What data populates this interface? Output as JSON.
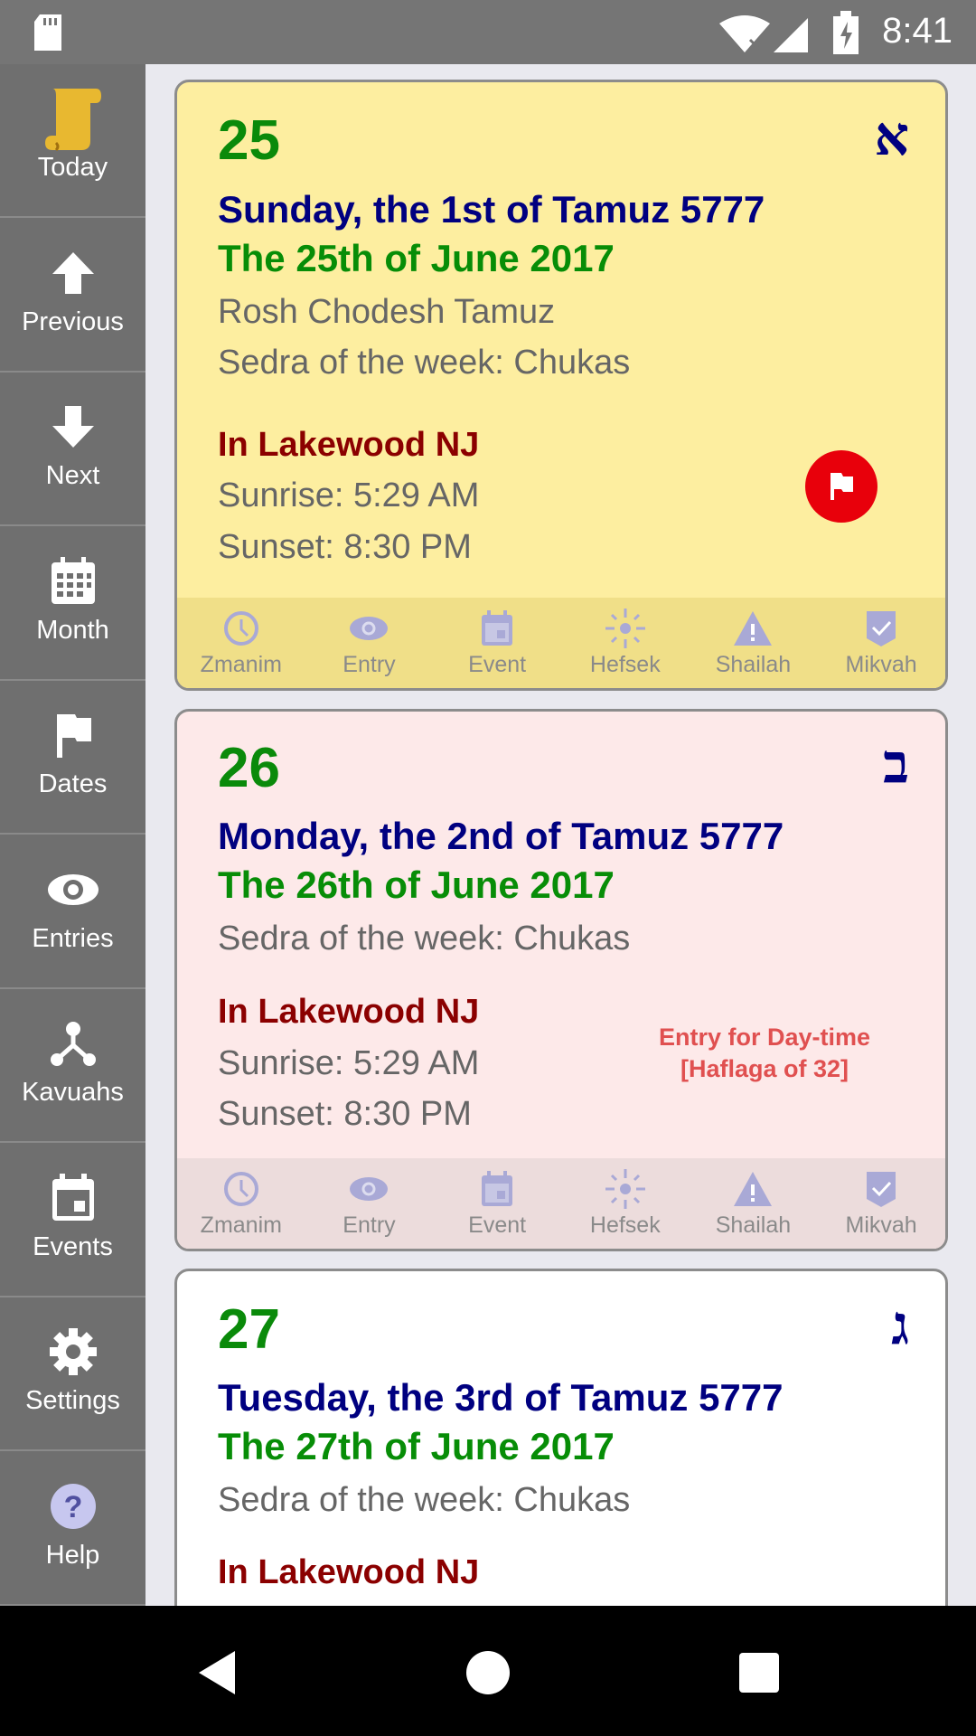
{
  "status_bar": {
    "time": "8:41",
    "icons": [
      "sd-card-icon",
      "wifi-off-icon",
      "signal-icon",
      "battery-charging-icon"
    ]
  },
  "sidebar": {
    "items": [
      {
        "label": "Today",
        "icon": "scroll-icon"
      },
      {
        "label": "Previous",
        "icon": "arrow-up-icon"
      },
      {
        "label": "Next",
        "icon": "arrow-down-icon"
      },
      {
        "label": "Month",
        "icon": "calendar-month-icon"
      },
      {
        "label": "Dates",
        "icon": "flag-icon"
      },
      {
        "label": "Entries",
        "icon": "eye-icon"
      },
      {
        "label": "Kavuahs",
        "icon": "fork-icon"
      },
      {
        "label": "Events",
        "icon": "event-icon"
      },
      {
        "label": "Settings",
        "icon": "gear-icon"
      },
      {
        "label": "Help",
        "icon": "help-icon"
      }
    ]
  },
  "toolbar_labels": [
    "Zmanim",
    "Entry",
    "Event",
    "Hefsek",
    "Shailah",
    "Mikvah"
  ],
  "colors": {
    "card_today_bg": "#fdeea0",
    "card_entry_bg": "#fde9e9",
    "card_plain_bg": "#ffffff",
    "flag_red": "#e8000b",
    "icon_lavender": "#a9a9d6"
  },
  "days": [
    {
      "day": "25",
      "hebrew_letter": "א",
      "jewish_date": "Sunday, the 1st of Tamuz 5777",
      "secular_date": "The 25th of June 2017",
      "notes": [
        "Rosh Chodesh Tamuz",
        "Sedra of the week: Chukas"
      ],
      "location": "In Lakewood NJ",
      "sunrise": "Sunrise: 5:29 AM",
      "sunset": "Sunset: 8:30 PM",
      "flagged": true
    },
    {
      "day": "26",
      "hebrew_letter": "ב",
      "jewish_date": "Monday, the 2nd of Tamuz 5777",
      "secular_date": "The 26th of June 2017",
      "notes": [
        "Sedra of the week: Chukas"
      ],
      "location": "In Lakewood NJ",
      "sunrise": "Sunrise: 5:29 AM",
      "sunset": "Sunset: 8:30 PM",
      "entry_note": [
        "Entry for Day-time",
        "[Haflaga of 32]"
      ]
    },
    {
      "day": "27",
      "hebrew_letter": "ג",
      "jewish_date": "Tuesday, the 3rd of Tamuz 5777",
      "secular_date": "The 27th of June 2017",
      "notes": [
        "Sedra of the week: Chukas"
      ],
      "location": "In Lakewood NJ"
    }
  ]
}
